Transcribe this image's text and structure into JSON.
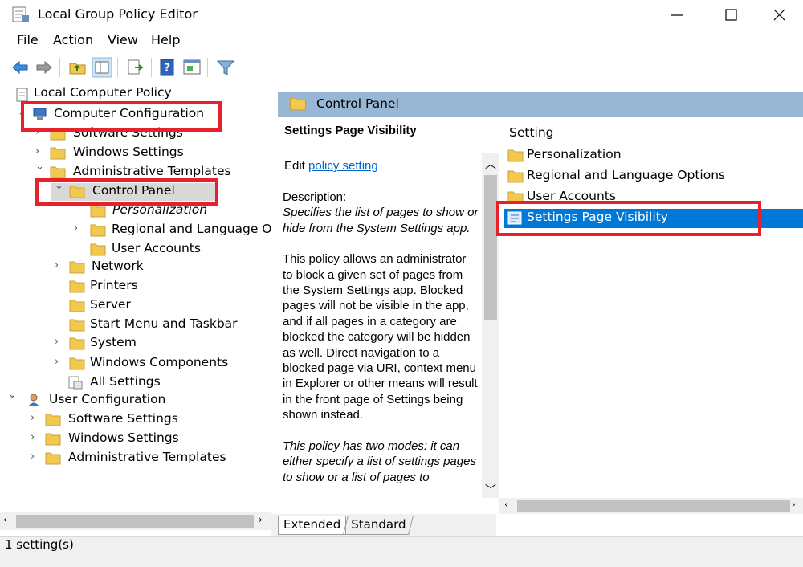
{
  "window": {
    "title": "Local Group Policy Editor",
    "controls": {
      "minimize": "—",
      "maximize": "☐",
      "close": "✕"
    }
  },
  "menu": [
    "File",
    "Action",
    "View",
    "Help"
  ],
  "toolbar": {
    "buttons": [
      "back-icon",
      "forward-icon",
      "up-folder-icon",
      "show-hide-tree-icon",
      "export-list-icon",
      "help-icon",
      "properties-icon",
      "filter-icon"
    ]
  },
  "tree": {
    "root": "Local Computer Policy",
    "computer_configuration": "Computer Configuration",
    "cc_software_settings": "Software Settings",
    "cc_windows_settings": "Windows Settings",
    "cc_admin_templates": "Administrative Templates",
    "control_panel": "Control Panel",
    "personalization": "Personalization",
    "regional": "Regional and Language Opti",
    "user_accounts": "User Accounts",
    "network": "Network",
    "printers": "Printers",
    "server": "Server",
    "start_menu": "Start Menu and Taskbar",
    "system": "System",
    "windows_components": "Windows Components",
    "all_settings": "All Settings",
    "user_configuration": "User Configuration",
    "uc_software_settings": "Software Settings",
    "uc_windows_settings": "Windows Settings",
    "uc_admin_templates": "Administrative Templates"
  },
  "details": {
    "header": "Control Panel",
    "policy_title": "Settings Page Visibility",
    "edit_prefix": "Edit ",
    "edit_link": "policy setting",
    "description_label": "Description:",
    "description_1": "Specifies the list of pages to show or hide from the System Settings app.",
    "description_2": "This policy allows an administrator to block a given set of pages from the System Settings app. Blocked pages will not be visible in the app, and if all pages in a category are blocked the category will be hidden as well. Direct navigation to a blocked page via URI, context menu in Explorer or other means will result in the front page of Settings being shown instead.",
    "description_3": "This policy has two modes: it can either specify a list of settings pages to show or a list of pages to"
  },
  "tabs": {
    "extended": "Extended",
    "standard": "Standard"
  },
  "list": {
    "column_header": "Setting",
    "items": [
      {
        "label": "Personalization",
        "icon": "folder-icon"
      },
      {
        "label": "Regional and Language Options",
        "icon": "folder-icon"
      },
      {
        "label": "User Accounts",
        "icon": "folder-icon"
      },
      {
        "label": "Settings Page Visibility",
        "icon": "policy-setting-icon",
        "selected": true
      }
    ]
  },
  "status": {
    "text": "1 setting(s)"
  },
  "colors": {
    "accent": "#0078d7",
    "header": "#98b7d4",
    "annotation": "#e8202a",
    "folder": "#f2c94c"
  }
}
